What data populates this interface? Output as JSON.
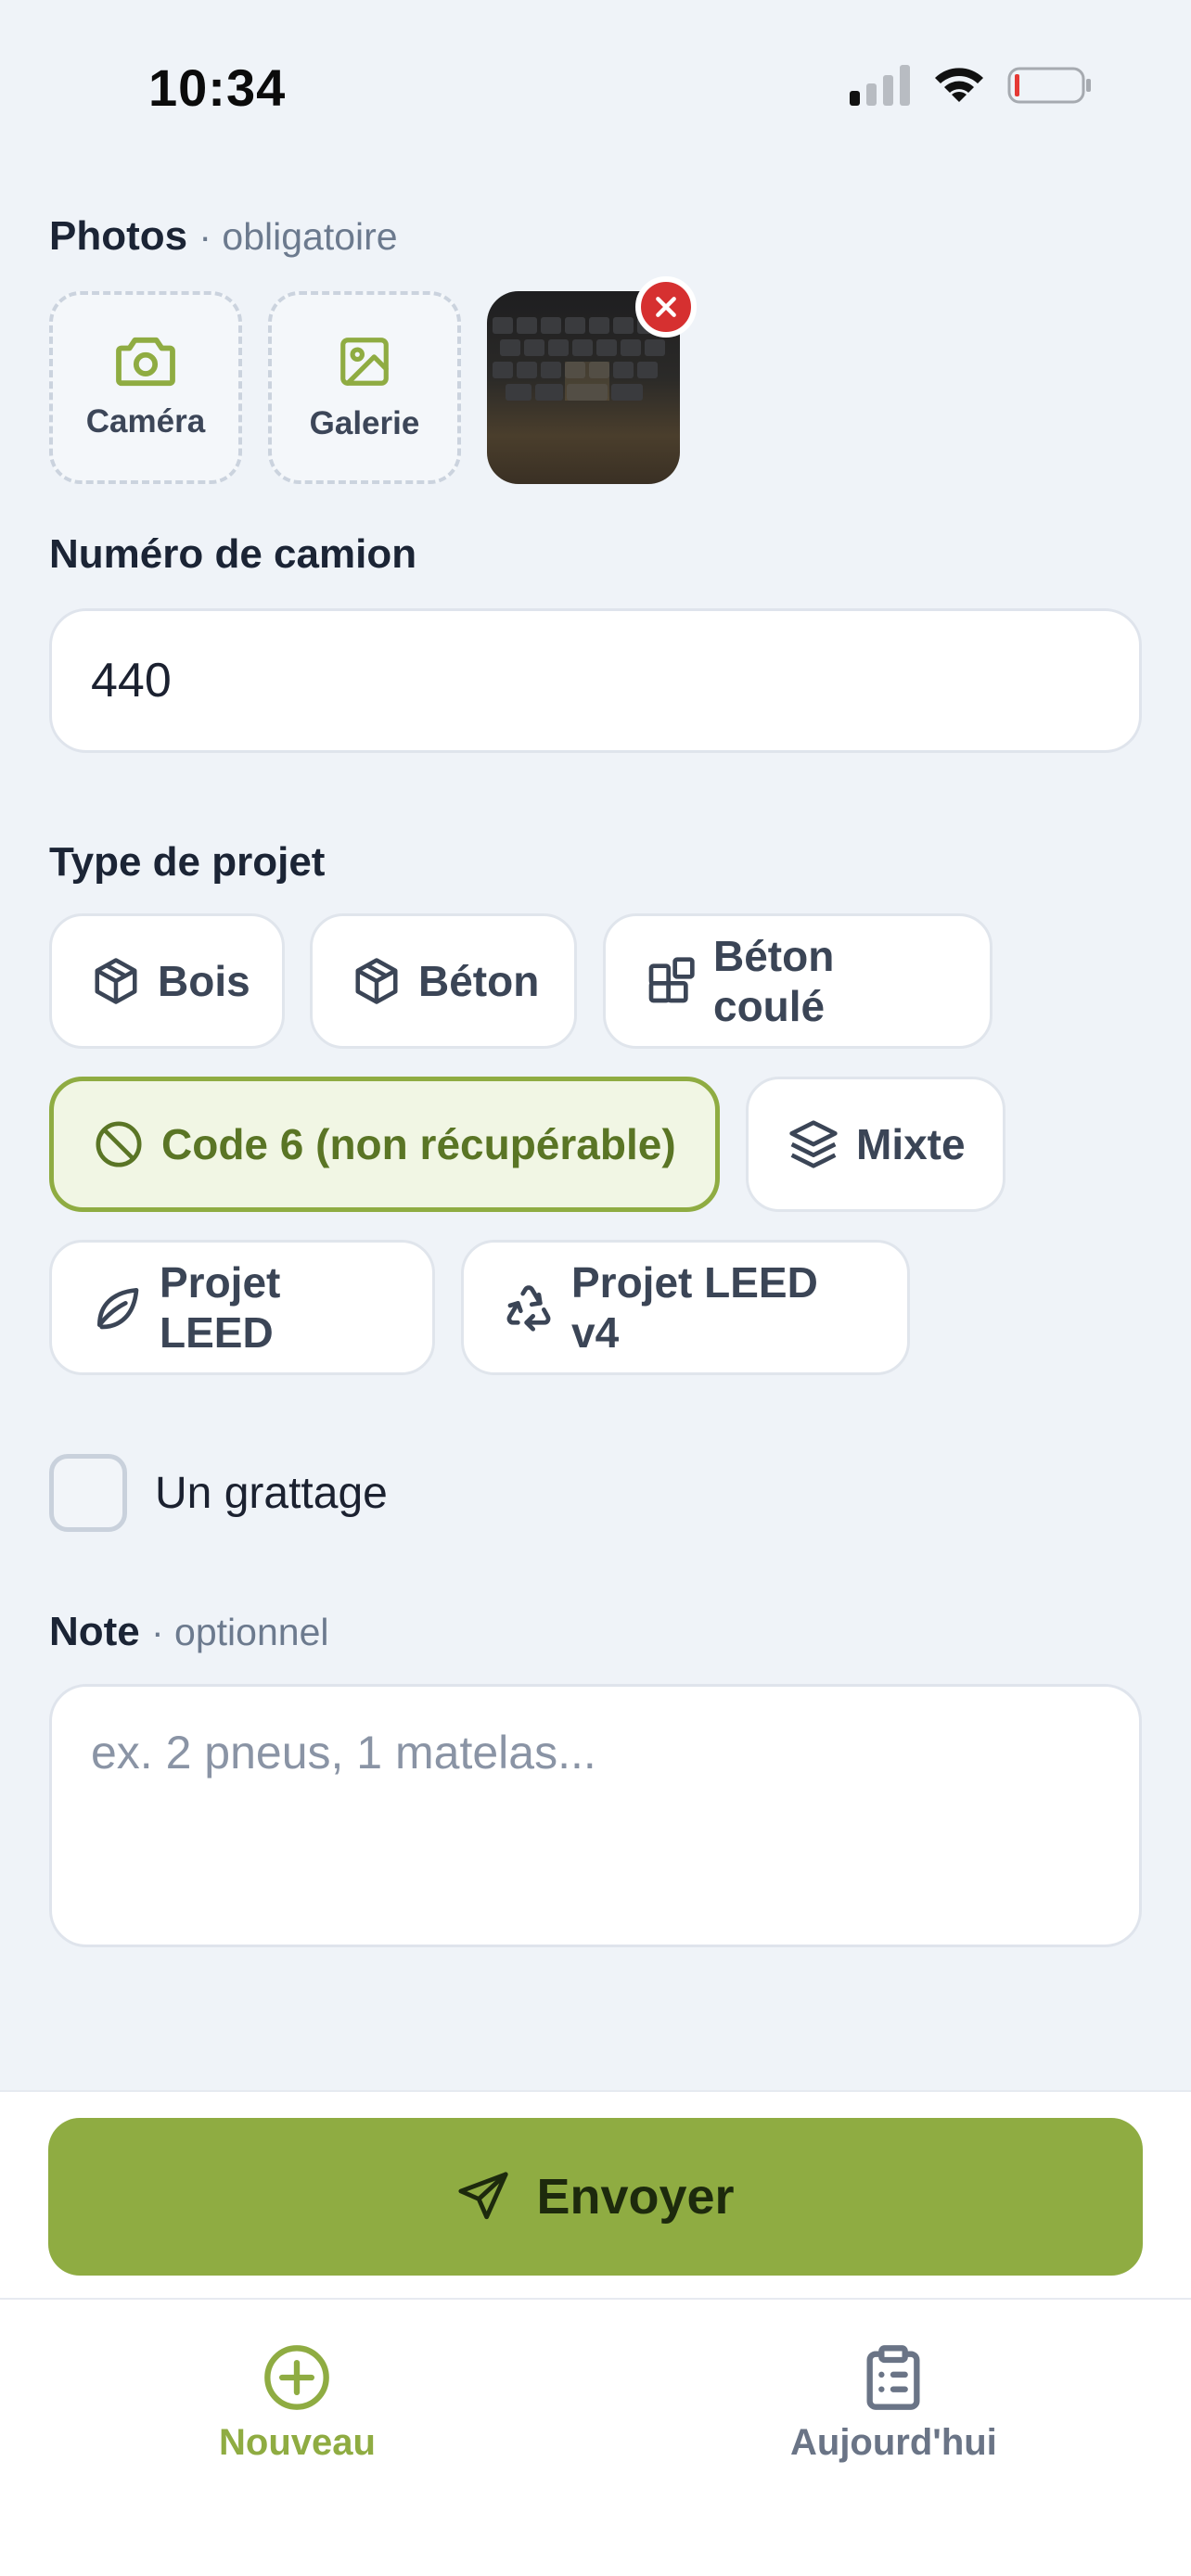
{
  "status_bar": {
    "time": "10:34"
  },
  "photos": {
    "label": "Photos",
    "sub": "· obligatoire",
    "camera_label": "Caméra",
    "gallery_label": "Galerie"
  },
  "truck": {
    "label": "Numéro de camion",
    "value": "440"
  },
  "project_type": {
    "label": "Type de projet",
    "options": [
      {
        "label": "Bois",
        "icon": "box-icon"
      },
      {
        "label": "Béton",
        "icon": "box-icon"
      },
      {
        "label": "Béton coulé",
        "icon": "blocks-icon"
      },
      {
        "label": "Code 6 (non récupérable)",
        "icon": "ban-icon",
        "selected": true
      },
      {
        "label": "Mixte",
        "icon": "layers-icon"
      },
      {
        "label": "Projet LEED",
        "icon": "leaf-icon"
      },
      {
        "label": "Projet LEED v4",
        "icon": "recycle-icon"
      }
    ]
  },
  "scraping": {
    "label": "Un grattage",
    "checked": false
  },
  "note": {
    "label": "Note",
    "sub": "· optionnel",
    "placeholder": "ex. 2 pneus, 1 matelas..."
  },
  "submit": {
    "label": "Envoyer"
  },
  "tabs": [
    {
      "label": "Nouveau",
      "icon": "plus-circle-icon",
      "active": true
    },
    {
      "label": "Aujourd'hui",
      "icon": "clipboard-list-icon",
      "active": false
    }
  ],
  "colors": {
    "accent": "#8fac42",
    "background": "#eff3f8",
    "danger": "#d63030"
  }
}
